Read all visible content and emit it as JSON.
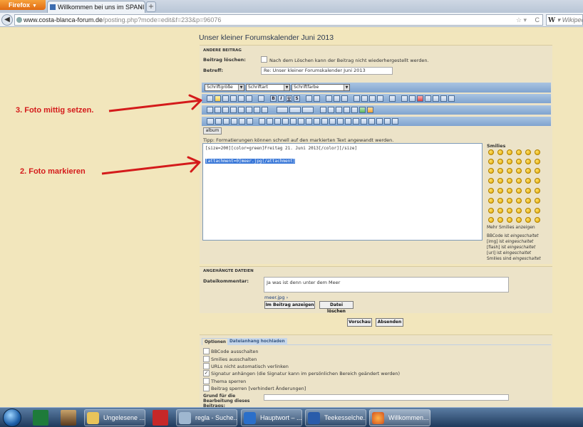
{
  "browser": {
    "menu_button": "Firefox",
    "tab_title": "Willkommen bei uns im SPANIE...",
    "url_host": "www.costa-blanca-forum.de",
    "url_path": "/posting.php?mode=edit&f=233&p=96076",
    "search_engine": "Wikipedia"
  },
  "page": {
    "title": "Unser kleiner Forumskalender Juni 2013",
    "section_other": "Andere Beitrag",
    "delete_label": "Beitrag löschen:",
    "delete_hint": "Nach dem Löschen kann der Beitrag nicht wiederhergestellt werden.",
    "subject_label": "Betreff:",
    "subject_value": "Re: Unser kleiner Forumskalender Juni 2013",
    "font_size_select": "Schriftgröße",
    "font_face_select": "Schriftart",
    "font_color_select": "Schriftfarbe",
    "album_button": "album",
    "tip": "Tipp: Formatierungen können schnell auf den markierten Text angewandt werden.",
    "editor_line1": "[size=200][color=green]Freitag 21. Juni 2013[/color][/size]",
    "editor_line2": "[attachment=0]meer.jpg[/attachment]",
    "smilies_title": "Smilies",
    "more_smilies": "Mehr Smilies anzeigen",
    "bbcode_status": [
      {
        "label": "BBCode",
        "state": "eingeschaltet"
      },
      {
        "label": "[img]",
        "state": "eingeschaltet"
      },
      {
        "label": "[flash]",
        "state": "eingeschaltet"
      },
      {
        "label": "[url]",
        "state": "eingeschaltet"
      },
      {
        "label": "Smilies sind",
        "state": "eingeschaltet"
      }
    ],
    "attachments_title": "Angehängte Dateien",
    "file_comment_label": "Dateikommentar:",
    "file_comment_value": "Ja was ist denn unter dem Meer",
    "file_name": "meer.jpg ›",
    "insert_button": "Im Beitrag anzeigen",
    "delete_file_button": "Datei löschen",
    "preview_button": "Vorschau",
    "submit_button": "Absenden",
    "tab_options": "Optionen",
    "tab_upload": "Dateianhang hochladen",
    "options": [
      "BBCode ausschalten",
      "Smilies ausschalten",
      "URLs nicht automatisch verlinken",
      "Signatur anhängen (die Signatur kann im persönlichen Bereich geändert werden)",
      "Thema sperren",
      "Beitrag sperren [verhindert Änderungen]"
    ],
    "reason_label": "Grund für die Bearbeitung dieses Beitrags:"
  },
  "annotations": {
    "step3": "3. Foto mittig setzen.",
    "step2": "2. Foto markieren",
    "color": "#D41B1B"
  },
  "taskbar": {
    "items": [
      "Ungelesene ...",
      "regla - Suche...",
      "Hauptwort – ...",
      "Teekesselche...",
      "Willkommen..."
    ]
  }
}
